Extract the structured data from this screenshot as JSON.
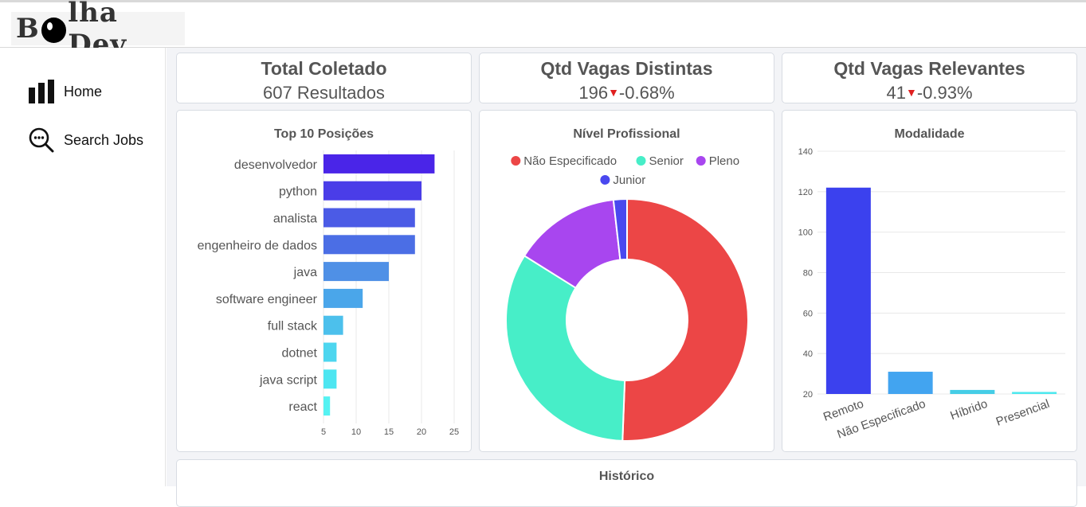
{
  "app": {
    "logo_prefix": "B",
    "logo_suffix": "lha Dev"
  },
  "sidebar": {
    "items": [
      {
        "label": "Home",
        "icon": "bar-chart-icon"
      },
      {
        "label": "Search Jobs",
        "icon": "search-dots-icon"
      }
    ]
  },
  "kpis": [
    {
      "title": "Total Coletado",
      "value": "607 Resultados"
    },
    {
      "title": "Qtd Vagas Distintas",
      "value": "196",
      "delta": "-0.68%",
      "delta_color": "#e02020"
    },
    {
      "title": "Qtd Vagas Relevantes",
      "value": "41",
      "delta": "-0.93%",
      "delta_color": "#e02020"
    }
  ],
  "chart_data": [
    {
      "type": "bar",
      "orientation": "horizontal",
      "title": "Top 10 Posições",
      "categories": [
        "desenvolvedor",
        "python",
        "analista",
        "engenheiro de dados",
        "java",
        "software engineer",
        "full stack",
        "dotnet",
        "java script",
        "react"
      ],
      "values": [
        22,
        20,
        19,
        19,
        15,
        11,
        8,
        7,
        7,
        6
      ],
      "xlim": [
        5,
        25
      ],
      "xticks": [
        "5",
        "10",
        "15",
        "20",
        "25"
      ],
      "colors": [
        "#4a25e8",
        "#4a3de8",
        "#4b5be6",
        "#4b6ee5",
        "#4f90e6",
        "#4aa6ea",
        "#4cc0ec",
        "#4dd6ef",
        "#4de6f1",
        "#55f2f2"
      ],
      "grid": true
    },
    {
      "type": "pie",
      "variant": "doughnut",
      "title": "Nível Profissional",
      "labels": [
        "Não Especificado",
        "Senior",
        "Pleno",
        "Junior"
      ],
      "values": [
        50.6,
        33.3,
        14.3,
        1.8
      ],
      "colors": [
        "#ec4646",
        "#47eec8",
        "#a846ef",
        "#4a48ef"
      ],
      "legend": "top"
    },
    {
      "type": "bar",
      "title": "Modalidade",
      "categories": [
        "Remoto",
        "Não Especificado",
        "Híbrido",
        "Presencial"
      ],
      "values": [
        122,
        31,
        22,
        21
      ],
      "ylim": [
        20,
        140
      ],
      "yticks": [
        "20",
        "40",
        "60",
        "80",
        "100",
        "120",
        "140"
      ],
      "colors": [
        "#3b41ee",
        "#42a4f0",
        "#45cde6",
        "#4de8ee"
      ],
      "grid": true
    }
  ],
  "historico": {
    "title": "Histórico"
  }
}
